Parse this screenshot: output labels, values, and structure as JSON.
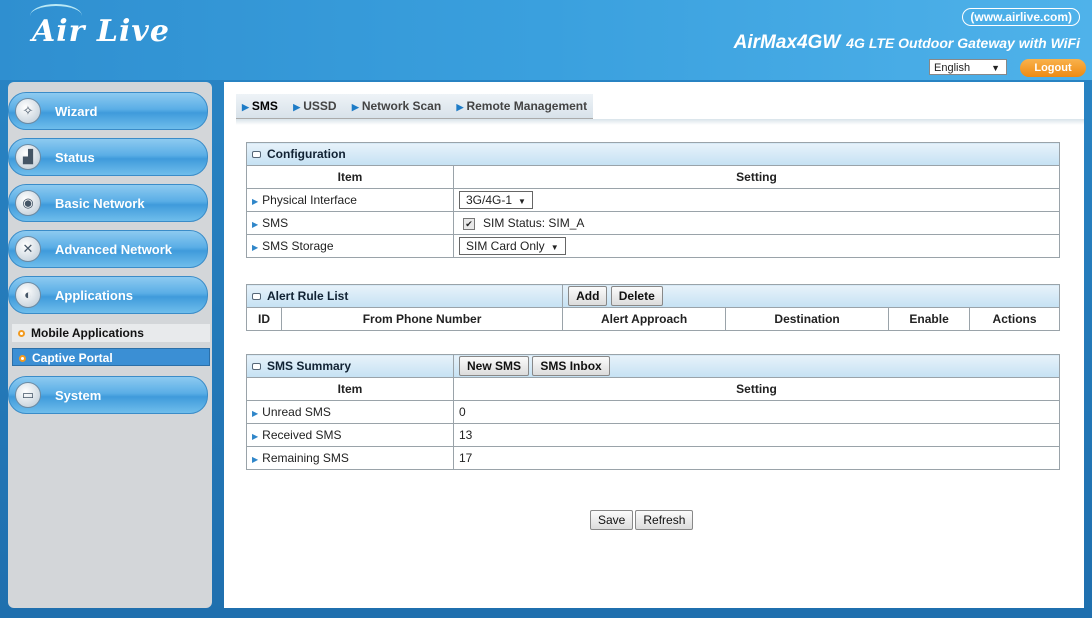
{
  "header": {
    "brand": "Air Live",
    "site_url": "(www.airlive.com)",
    "model": "AirMax4GW",
    "description": "4G LTE Outdoor Gateway with WiFi",
    "language": "English",
    "logout_label": "Logout"
  },
  "sidebar": {
    "items": [
      {
        "label": "Wizard",
        "icon": "wand-icon"
      },
      {
        "label": "Status",
        "icon": "chart-icon"
      },
      {
        "label": "Basic Network",
        "icon": "globe-icon"
      },
      {
        "label": "Advanced Network",
        "icon": "tools-icon"
      },
      {
        "label": "Applications",
        "icon": "apps-icon"
      },
      {
        "label": "System",
        "icon": "monitor-icon"
      }
    ],
    "subitems": [
      {
        "label": "Mobile Applications"
      },
      {
        "label": "Captive Portal"
      }
    ]
  },
  "tabs": [
    "SMS",
    "USSD",
    "Network Scan",
    "Remote Management"
  ],
  "configuration": {
    "title": "Configuration",
    "col_item": "Item",
    "col_setting": "Setting",
    "physical_interface_label": "Physical Interface",
    "physical_interface_value": "3G/4G-1",
    "sms_label": "SMS",
    "sim_status": "SIM Status: SIM_A",
    "sms_storage_label": "SMS Storage",
    "sms_storage_value": "SIM Card Only"
  },
  "alert_rule_list": {
    "title": "Alert Rule List",
    "add_label": "Add",
    "delete_label": "Delete",
    "columns": [
      "ID",
      "From Phone Number",
      "Alert Approach",
      "Destination",
      "Enable",
      "Actions"
    ]
  },
  "sms_summary": {
    "title": "SMS Summary",
    "new_sms_label": "New SMS",
    "inbox_label": "SMS Inbox",
    "col_item": "Item",
    "col_setting": "Setting",
    "rows": [
      {
        "label": "Unread SMS",
        "value": "0"
      },
      {
        "label": "Received SMS",
        "value": "13"
      },
      {
        "label": "Remaining SMS",
        "value": "17"
      }
    ]
  },
  "footer": {
    "save_label": "Save",
    "refresh_label": "Refresh"
  }
}
